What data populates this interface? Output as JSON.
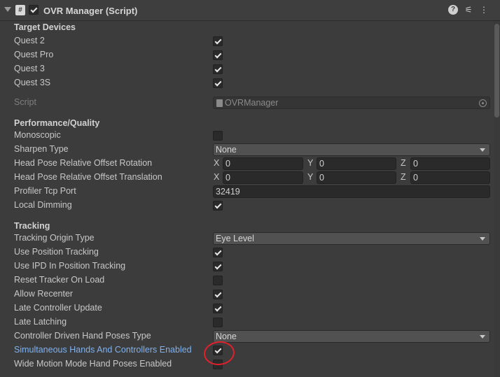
{
  "header": {
    "title": "OVR Manager (Script)",
    "enabled": true,
    "script_glyph": "#",
    "icons": [
      "fold-arrow-icon",
      "script-icon",
      "help-icon",
      "presets-icon",
      "more-menu-icon"
    ]
  },
  "sections": {
    "target_devices": "Target Devices",
    "performance": "Performance/Quality",
    "tracking": "Tracking"
  },
  "target_devices": [
    {
      "label": "Quest 2",
      "checked": true
    },
    {
      "label": "Quest Pro",
      "checked": true
    },
    {
      "label": "Quest 3",
      "checked": true
    },
    {
      "label": "Quest 3S",
      "checked": true
    }
  ],
  "script": {
    "label": "Script",
    "value": "OVRManager"
  },
  "performance": {
    "monoscopic": {
      "label": "Monoscopic",
      "checked": false
    },
    "sharpen_type": {
      "label": "Sharpen Type",
      "value": "None"
    },
    "head_rot": {
      "label": "Head Pose Relative Offset Rotation",
      "x": "0",
      "y": "0",
      "z": "0"
    },
    "head_trans": {
      "label": "Head Pose Relative Offset Translation",
      "x": "0",
      "y": "0",
      "z": "0"
    },
    "profiler_port": {
      "label": "Profiler Tcp Port",
      "value": "32419"
    },
    "local_dimming": {
      "label": "Local Dimming",
      "checked": true
    }
  },
  "axis": {
    "x": "X",
    "y": "Y",
    "z": "Z"
  },
  "tracking": {
    "origin_type": {
      "label": "Tracking Origin Type",
      "value": "Eye Level"
    },
    "use_position": {
      "label": "Use Position Tracking",
      "checked": true
    },
    "use_ipd": {
      "label": "Use IPD In Position Tracking",
      "checked": true
    },
    "reset_tracker": {
      "label": "Reset Tracker On Load",
      "checked": false
    },
    "allow_recenter": {
      "label": "Allow Recenter",
      "checked": true
    },
    "late_controller": {
      "label": "Late Controller Update",
      "checked": true
    },
    "late_latching": {
      "label": "Late Latching",
      "checked": false
    },
    "hand_poses_type": {
      "label": "Controller Driven Hand Poses Type",
      "value": "None"
    },
    "simultaneous": {
      "label": "Simultaneous Hands And Controllers Enabled",
      "checked": true
    },
    "wide_motion": {
      "label": "Wide Motion Mode Hand Poses Enabled",
      "checked": false
    }
  },
  "colors": {
    "background": "#3c3c3c",
    "highlight_label": "#7fb2f0",
    "annotation": "#e0202a"
  }
}
